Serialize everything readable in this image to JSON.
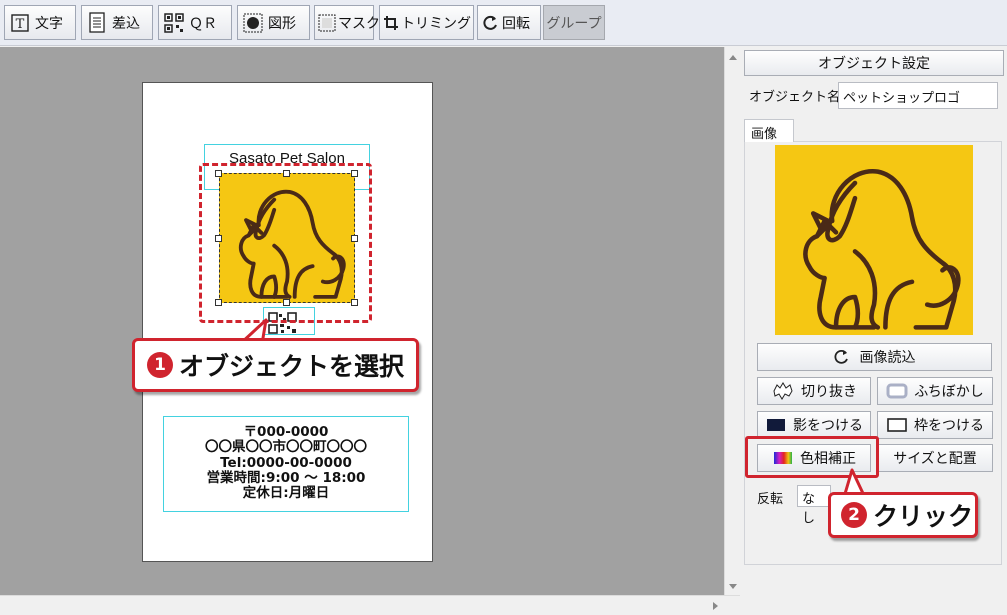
{
  "toolbar": {
    "text": "文字",
    "insert": "差込",
    "qr": "ＱＲ",
    "shape": "図形",
    "mask": "マスク",
    "trim": "トリミング",
    "rotate": "回転",
    "group": "グループ"
  },
  "canvas": {
    "salon_name": "Sasato Pet Salon",
    "address_lines": [
      "〒000-0000",
      "〇〇県〇〇市〇〇町〇〇〇",
      "Tel:0000-00-0000",
      "営業時間:9:00 〜 18:00",
      "定休日:月曜日"
    ]
  },
  "callouts": {
    "step1_num": "1",
    "step1_text": "オブジェクトを選択",
    "step2_num": "2",
    "step2_text": "クリック"
  },
  "panel": {
    "header": "オブジェクト設定",
    "object_name_label": "オブジェクト名",
    "object_name_value": "ペットショップロゴ",
    "tab_image": "画像",
    "load_image": "画像読込",
    "cutout": "切り抜き",
    "blur": "ふちぼかし",
    "shadow": "影をつける",
    "frame": "枠をつける",
    "color_adjust": "色相補正",
    "size_position": "サイズと配置",
    "flip_label": "反転",
    "flip_value": "なし"
  },
  "colors": {
    "accent_red": "#d0242e",
    "logo_yellow": "#f5c713",
    "logo_line": "#4a2a17",
    "guide_cyan": "#43d2e0"
  }
}
